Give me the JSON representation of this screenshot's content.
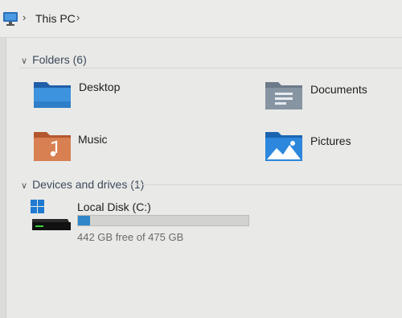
{
  "address_bar": {
    "icon": "this-pc-icon",
    "path": [
      "This PC"
    ]
  },
  "folders_section": {
    "header": "Folders (6)",
    "items": [
      {
        "label": "Desktop",
        "icon": "desktop-folder-icon"
      },
      {
        "label": "Documents",
        "icon": "documents-folder-icon"
      },
      {
        "label": "Music",
        "icon": "music-folder-icon"
      },
      {
        "label": "Pictures",
        "icon": "pictures-folder-icon"
      }
    ]
  },
  "drives_section": {
    "header": "Devices and drives (1)",
    "drives": [
      {
        "label": "Local Disk (C:)",
        "icon": "local-disk-icon",
        "free_text": "442 GB free of 475 GB",
        "used_fraction": 0.07
      }
    ]
  },
  "colors": {
    "accent": "#2f86c9",
    "folder_blue": "#2a78c8",
    "music_orange": "#d87a4a"
  }
}
